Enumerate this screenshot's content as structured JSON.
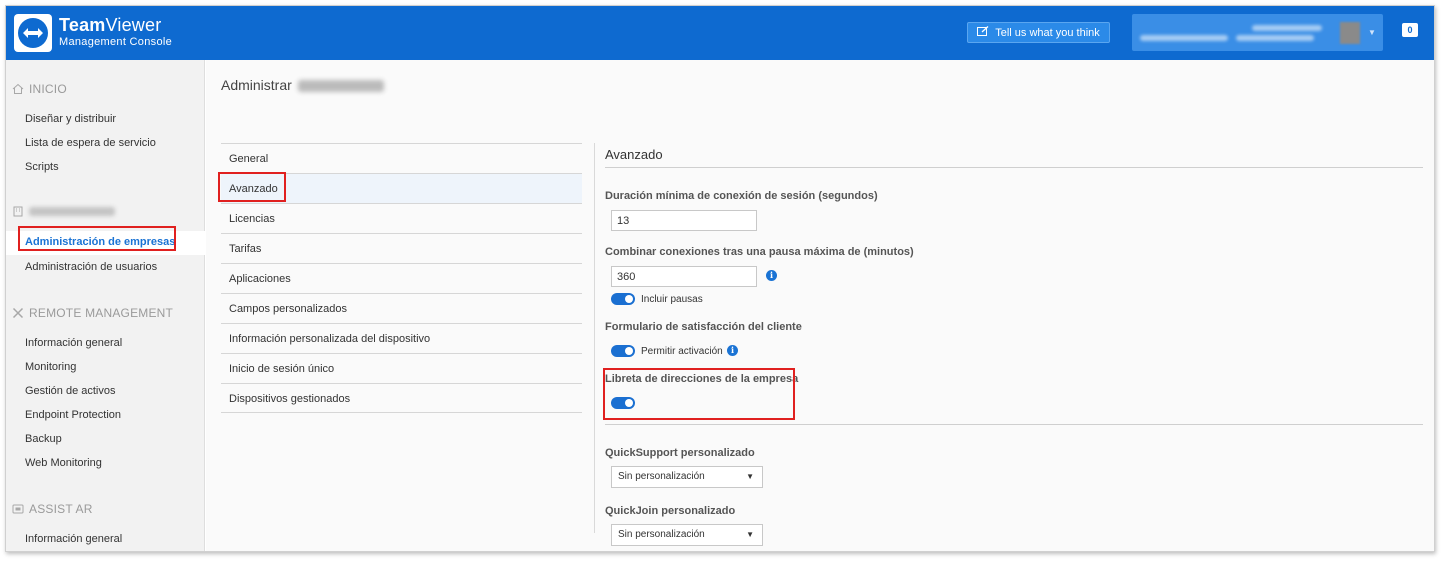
{
  "header": {
    "brand_bold": "Team",
    "brand_light": "Viewer",
    "brand_sub": "Management Console",
    "feedback_label": "Tell us what you think",
    "notification_count": "0"
  },
  "sidebar": {
    "inicio": "INICIO",
    "inicio_items": [
      "Diseñar y distribuir",
      "Lista de espera de servicio",
      "Scripts"
    ],
    "company_active": "Administración de empresas",
    "company_users": "Administración de usuarios",
    "remote": "REMOTE MANAGEMENT",
    "remote_items": [
      "Información general",
      "Monitoring",
      "Gestión de activos",
      "Endpoint Protection",
      "Backup",
      "Web Monitoring"
    ],
    "assist": "ASSIST AR",
    "assist_items": [
      "Información general"
    ]
  },
  "main": {
    "title": "Administrar",
    "tabs": [
      "General",
      "Avanzado",
      "Licencias",
      "Tarifas",
      "Aplicaciones",
      "Campos personalizados",
      "Información personalizada del dispositivo",
      "Inicio de sesión único",
      "Dispositivos gestionados"
    ],
    "active_tab_index": 1
  },
  "panel": {
    "title": "Avanzado",
    "min_duration_label": "Duración mínima de conexión de sesión (segundos)",
    "min_duration_value": "13",
    "combine_label": "Combinar conexiones tras una pausa máxima de (minutos)",
    "combine_value": "360",
    "include_pauses": "Incluir pausas",
    "satisfaction_label": "Formulario de satisfacción del cliente",
    "allow_activation": "Permitir activación",
    "addressbook_label": "Libreta de direcciones de la empresa",
    "quicksupport_label": "QuickSupport personalizado",
    "quicksupport_value": "Sin personalización",
    "quickjoin_label": "QuickJoin personalizado",
    "quickjoin_value": "Sin personalización",
    "toggles": {
      "include_pauses": true,
      "allow_activation": true,
      "addressbook": true
    }
  },
  "colors": {
    "header": "#0e6ad0",
    "accent": "#1a73d4",
    "highlight": "#e0201f"
  }
}
